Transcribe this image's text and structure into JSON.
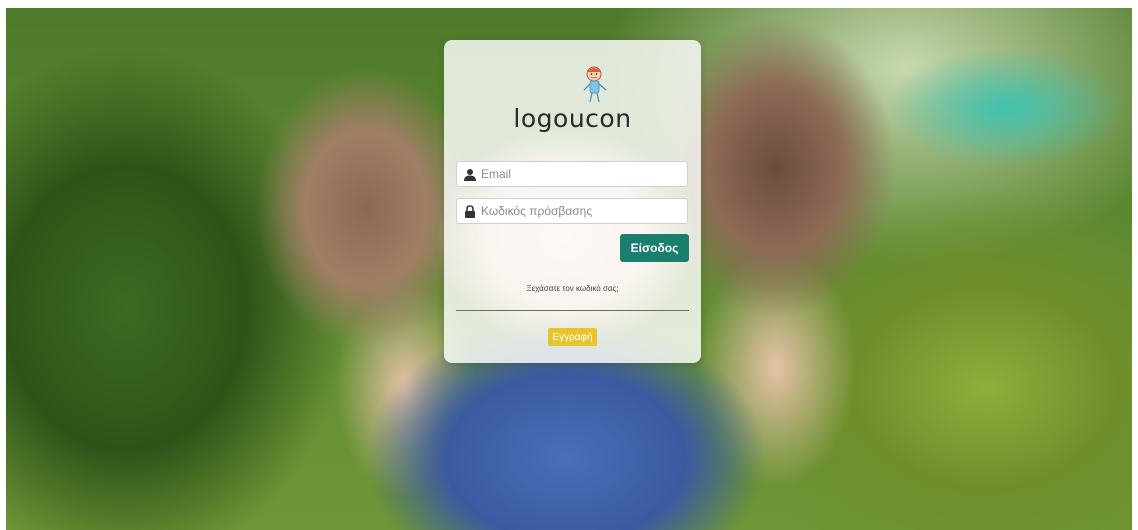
{
  "brand": {
    "logo_text": "logoucon"
  },
  "login_form": {
    "email_placeholder": "Email",
    "password_placeholder": "Κωδικός πρόσβασης",
    "login_label": "Είσοδος",
    "forgot_label": "Ξεχάσατε τον κωδικό σας;",
    "register_label": "Εγγραφή"
  },
  "colors": {
    "login_button": "#1a7f6e",
    "register_button": "#e8c42c",
    "card_background": "rgba(255,255,255,0.82)"
  },
  "icons": {
    "email": "user-icon",
    "password": "lock-icon",
    "logo": "child-mascot-icon"
  }
}
